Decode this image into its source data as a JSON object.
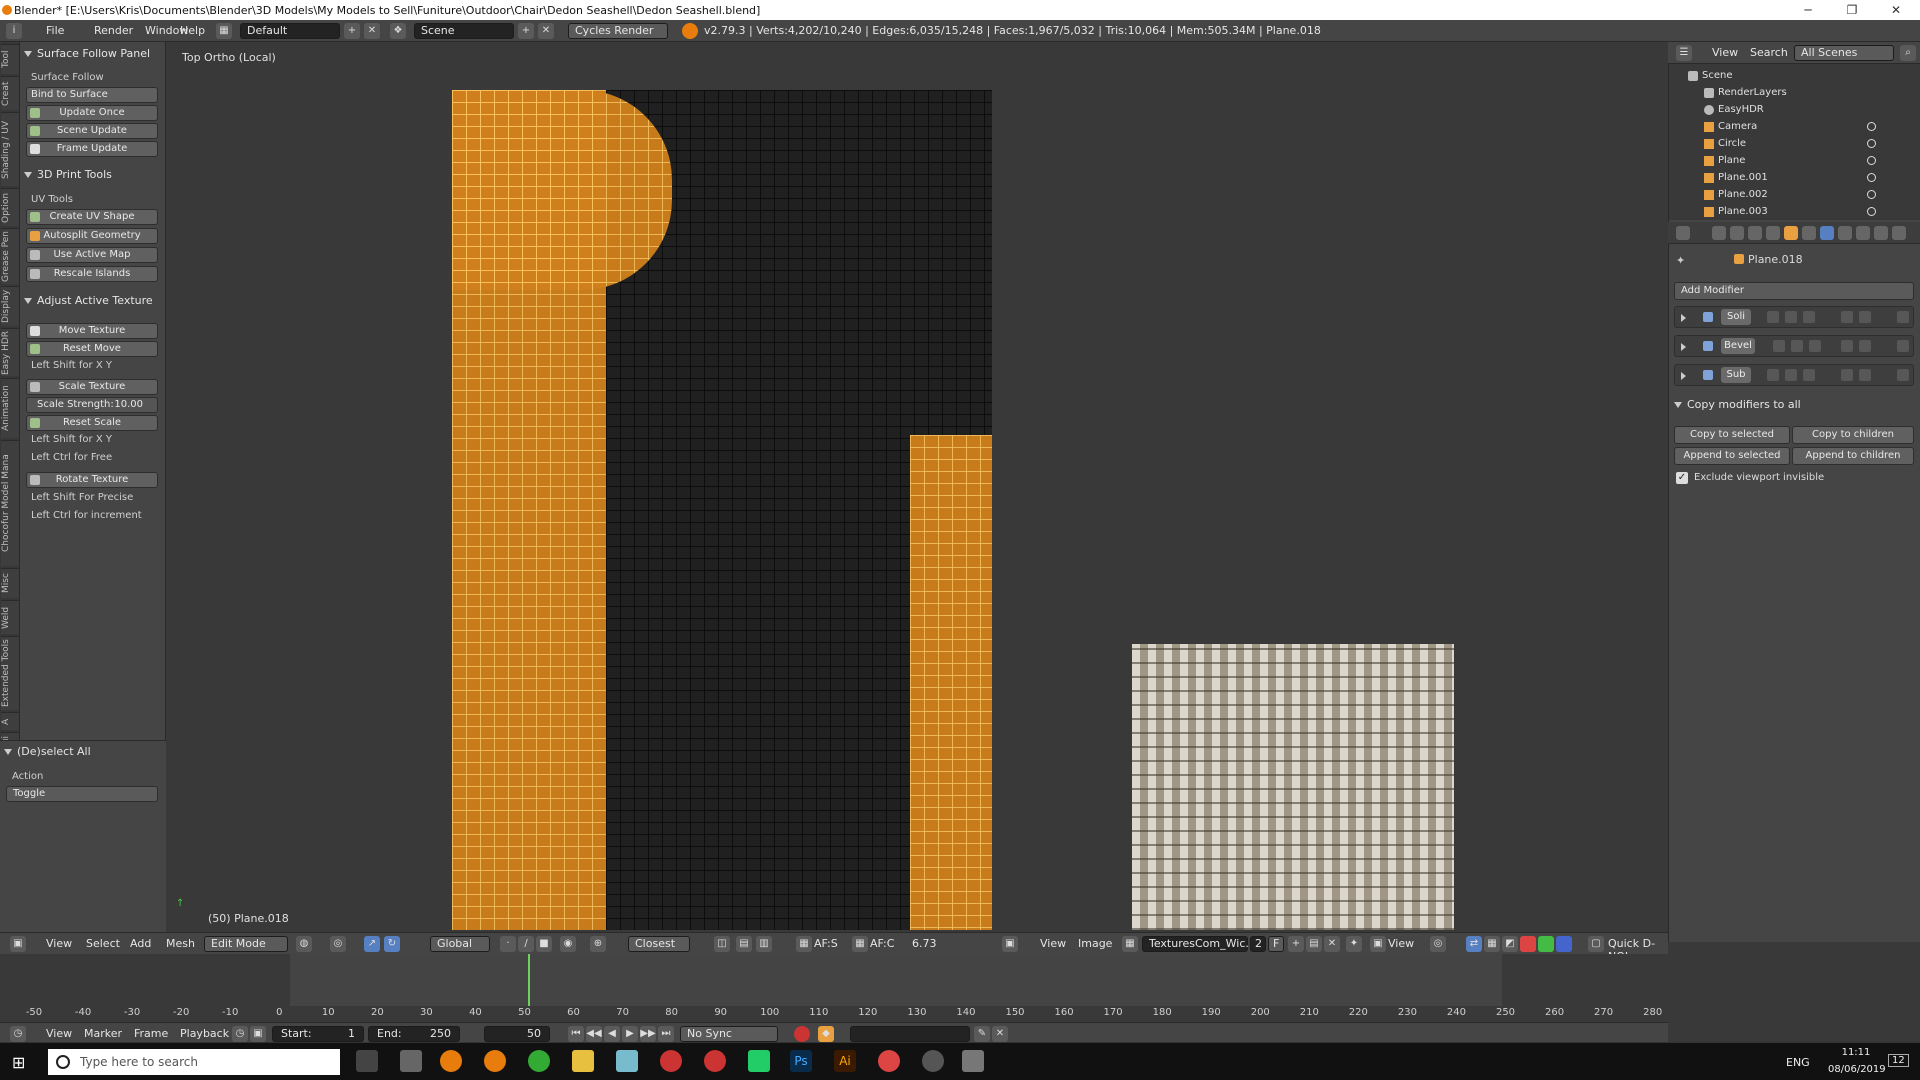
{
  "window": {
    "title": "Blender* [E:\\Users\\Kris\\Documents\\Blender\\3D Models\\My Models to Sell\\Funiture\\Outdoor\\Chair\\Dedon Seashell\\Dedon Seashell.blend]",
    "minimize": "─",
    "restore": "❐",
    "close": "✕"
  },
  "infobar": {
    "menus": [
      "File",
      "Render",
      "Window",
      "Help"
    ],
    "layout": "Default",
    "scene": "Scene",
    "engine": "Cycles Render",
    "stats": "v2.79.3 | Verts:4,202/10,240 | Edges:6,035/15,248 | Faces:1,967/5,032 | Tris:10,064 | Mem:505.34M | Plane.018"
  },
  "lefttabs": [
    "Tool",
    "Creat",
    "Shading / UV",
    "Option",
    "Grease Pen",
    "Display",
    "Easy HDR",
    "Animation",
    "Chocofur Model Mana",
    "Misc",
    "Weld",
    "Extended Tools",
    "A",
    "FLIP Flui"
  ],
  "toolpanel": {
    "surface_follow_panel": "Surface Follow Panel",
    "surface_follow": "Surface Follow",
    "bind_to_surface": "Bind to Surface",
    "update_once": "Update Once",
    "scene_update": "Scene Update",
    "frame_update": "Frame Update",
    "print_tools": "3D Print Tools",
    "uv_tools": "UV Tools",
    "create_uv_shape": "Create UV Shape",
    "autosplit_geometry": "Autosplit Geometry",
    "use_active_map": "Use Active Map",
    "rescale_islands": "Rescale Islands",
    "adjust_active_texture": "Adjust Active Texture",
    "move_texture": "Move Texture",
    "reset_move": "Reset Move",
    "left_shift_xy_1": "Left Shift for X Y",
    "scale_texture": "Scale Texture",
    "scale_strength_label": "Scale Strength:",
    "scale_strength_value": "10.00",
    "reset_scale": "Reset Scale",
    "left_shift_xy_2": "Left Shift for X Y",
    "left_ctrl_free": "Left Ctrl for Free",
    "rotate_texture": "Rotate Texture",
    "left_shift_precise": "Left Shift For Precise",
    "left_ctrl_increment": "Left Ctrl for increment"
  },
  "redo": {
    "title": "(De)select All",
    "action_label": "Action",
    "action_value": "Toggle"
  },
  "viewport": {
    "view_label": "Top Ortho (Local)",
    "object_label": "(50) Plane.018"
  },
  "vheader": {
    "view": "View",
    "select": "Select",
    "add": "Add",
    "mesh": "Mesh",
    "mode": "Edit Mode",
    "orientation": "Global",
    "snap": "Closest",
    "afs": "AF:S",
    "afc": "AF:C",
    "value": "6.73",
    "img_view": "View",
    "img_image": "Image",
    "img_name": "TexturesCom_Wic...",
    "img_users": "2",
    "img_f": "F",
    "img_view2": "View",
    "quick": "Quick D-NOI"
  },
  "ruler": [
    "-50",
    "-40",
    "-30",
    "-20",
    "-10",
    "0",
    "10",
    "20",
    "30",
    "40",
    "50",
    "60",
    "70",
    "80",
    "90",
    "100",
    "110",
    "120",
    "130",
    "140",
    "150",
    "160",
    "170",
    "180",
    "190",
    "200",
    "210",
    "220",
    "230",
    "240",
    "250",
    "260",
    "270",
    "280"
  ],
  "tlheader": {
    "view": "View",
    "marker": "Marker",
    "frame": "Frame",
    "playback": "Playback",
    "start_label": "Start:",
    "start": "1",
    "end_label": "End:",
    "end": "250",
    "current": "50",
    "sync": "No Sync"
  },
  "outliner": {
    "view": "View",
    "search": "Search",
    "scenes": "All Scenes",
    "items": [
      "Scene",
      "RenderLayers",
      "EasyHDR",
      "Camera",
      "Circle",
      "Plane",
      "Plane.001",
      "Plane.002",
      "Plane.003"
    ]
  },
  "props": {
    "object": "Plane.018",
    "add_modifier": "Add Modifier",
    "modifiers": [
      "Soli",
      "Bevel",
      "Sub"
    ],
    "copy_section": "Copy modifiers to all",
    "copy_to_selected": "Copy to selected",
    "copy_to_children": "Copy to children",
    "append_to_selected": "Append to selected",
    "append_to_children": "Append to children",
    "exclude_viewport": "Exclude viewport invisible"
  },
  "taskbar": {
    "search": "Type here to search",
    "lang": "ENG",
    "time": "11:11",
    "date": "08/06/2019",
    "notif": "12"
  },
  "colors": {
    "accent": "#e87d0d",
    "selected_mesh": "#d0801b",
    "panel": "#454545",
    "viewport": "#393939"
  }
}
